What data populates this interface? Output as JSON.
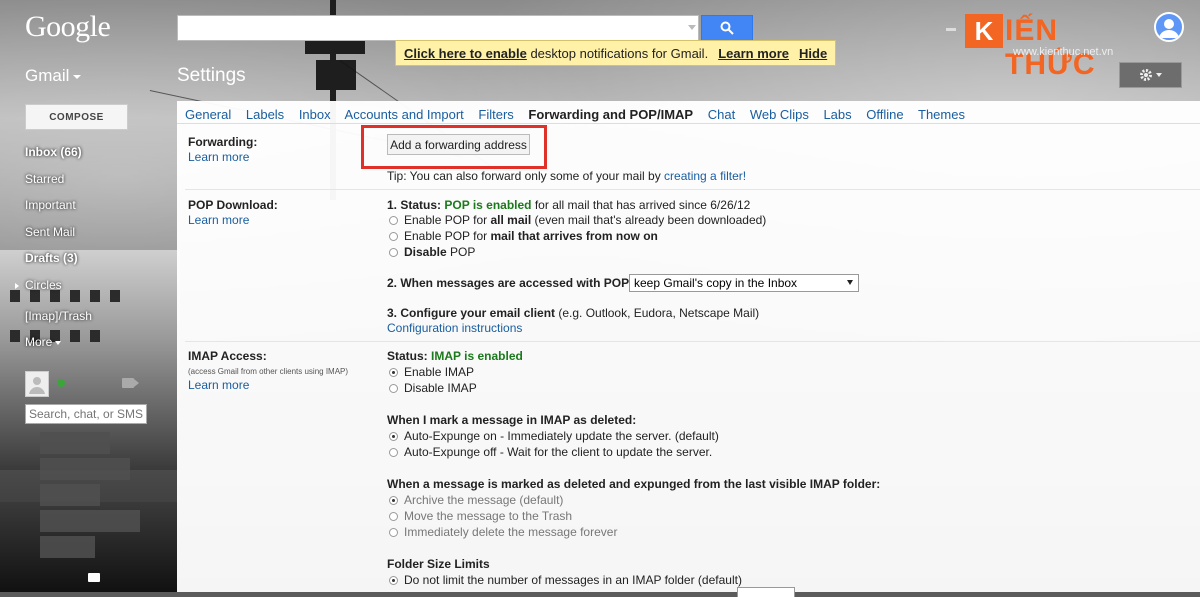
{
  "header": {
    "logo": "Google",
    "search_placeholder": "",
    "notification": {
      "link1": "Click here to enable",
      "text": " desktop notifications for Gmail.",
      "learn_more": "Learn more",
      "hide": "Hide"
    },
    "watermark": {
      "letter": "K",
      "text": "IẾN THỨC",
      "url": "www.kienthuc.net.vn"
    }
  },
  "app_label": "Gmail",
  "page_title": "Settings",
  "sidebar": {
    "compose": "COMPOSE",
    "items": [
      {
        "label": "Inbox (66)"
      },
      {
        "label": "Starred"
      },
      {
        "label": "Important"
      },
      {
        "label": "Sent Mail"
      },
      {
        "label": "Drafts (3)"
      },
      {
        "label": "Circles"
      },
      {
        "label": "[Imap]/Trash"
      },
      {
        "label": "More"
      }
    ],
    "chat_search_placeholder": "Search, chat, or SMS"
  },
  "tabs": [
    {
      "label": "General"
    },
    {
      "label": "Labels"
    },
    {
      "label": "Inbox"
    },
    {
      "label": "Accounts and Import"
    },
    {
      "label": "Filters"
    },
    {
      "label": "Forwarding and POP/IMAP",
      "active": true
    },
    {
      "label": "Chat"
    },
    {
      "label": "Web Clips"
    },
    {
      "label": "Labs"
    },
    {
      "label": "Offline"
    },
    {
      "label": "Themes"
    }
  ],
  "forwarding": {
    "label": "Forwarding:",
    "learn_more": "Learn more",
    "button": "Add a forwarding address",
    "tip_prefix": "Tip: You can also forward only some of your mail by ",
    "tip_link": "creating a filter!"
  },
  "pop": {
    "label": "POP Download:",
    "learn_more": "Learn more",
    "status_prefix": "1. Status: ",
    "status_value": "POP is enabled",
    "status_suffix": " for all mail that has arrived since 6/26/12",
    "options": [
      {
        "pre": "Enable POP for ",
        "bold": "all mail",
        "post": " (even mail that's already been downloaded)"
      },
      {
        "pre": "Enable POP for ",
        "bold": "mail that arrives from now on",
        "post": ""
      },
      {
        "pre": "",
        "bold": "Disable",
        "post": " POP"
      }
    ],
    "accessed_label": "2. When messages are accessed with POP",
    "accessed_value": "keep Gmail's copy in the Inbox",
    "configure_label": "3. Configure your email client",
    "configure_suffix": " (e.g. Outlook, Eudora, Netscape Mail)",
    "configure_link": "Configuration instructions"
  },
  "imap": {
    "label": "IMAP Access:",
    "sub": "(access Gmail from other clients using IMAP)",
    "learn_more": "Learn more",
    "status_prefix": "Status: ",
    "status_value": "IMAP is enabled",
    "enable": "Enable IMAP",
    "disable": "Disable IMAP",
    "deleted_heading": "When I mark a message in IMAP as deleted:",
    "deleted_options": [
      "Auto-Expunge on - Immediately update the server. (default)",
      "Auto-Expunge off - Wait for the client to update the server."
    ],
    "expunged_heading": "When a message is marked as deleted and expunged from the last visible IMAP folder:",
    "expunged_options": [
      "Archive the message (default)",
      "Move the message to the Trash",
      "Immediately delete the message forever"
    ],
    "folder_heading": "Folder Size Limits",
    "folder_option": "Do not limit the number of messages in an IMAP folder (default)"
  },
  "colors": {
    "accent": "#4285f4",
    "link": "#1a5ea0",
    "status_green": "#1b7a1b",
    "highlight": "#e0302a",
    "notification_bg": "#fff1a8"
  }
}
